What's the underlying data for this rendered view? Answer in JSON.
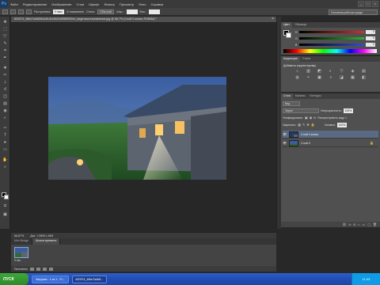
{
  "app": {
    "logo": "Ps"
  },
  "menu": [
    "Файл",
    "Редактирование",
    "Изображение",
    "Слои",
    "Шрифт",
    "Фильтр",
    "Просмотр",
    "Окно",
    "Справка"
  ],
  "window_controls": {
    "minimize": "_",
    "maximize": "□",
    "close": "×"
  },
  "options": {
    "feather_label": "Растушевка:",
    "feather_value": "0 пикс",
    "smoothing_label": "Сглаживание",
    "style_label": "Стиль:",
    "style_value": "Обычный",
    "width_label": "Шир.:",
    "height_label": "Выс.:",
    "workspace": "Основная рабочая среда"
  },
  "document": {
    "tab_title": "620374_46bc7a4b69b4c61d1e2b20d2589932cb_large-восстановление.jpg @ 66,7% (Слой 0 копия, RGB/8#) *",
    "close": "×"
  },
  "status": {
    "zoom": "66,67%",
    "doc_size": "Док: 1,58M/1,46M"
  },
  "bottom_tabs": {
    "mini_bridge": "Mini Bridge",
    "timeline": "Шкала времени"
  },
  "animation": {
    "frame_time": "0 сек.",
    "loop": "Постоянно"
  },
  "color_panel": {
    "tabs": [
      "Цвет",
      "Образцы"
    ],
    "sliders": [
      {
        "letter": "R",
        "value": "0",
        "color": "#d03030"
      },
      {
        "letter": "G",
        "value": "0",
        "color": "#30b030"
      },
      {
        "letter": "B",
        "value": "0",
        "color": "#3050d0"
      }
    ]
  },
  "adjustments_panel": {
    "tabs": [
      "Коррекция",
      "Стили"
    ],
    "title": "Добавить корректировку",
    "icons": [
      "☼",
      "▥",
      "◩",
      "◐",
      "▽",
      "◈",
      "▤",
      "◍",
      "◓",
      "▣",
      "◑",
      "◪",
      "▦",
      "◧"
    ]
  },
  "layers_panel": {
    "tabs": [
      "Слои",
      "Каналы",
      "Контуры"
    ],
    "kind_filter": "Вид",
    "blend_mode": "Экран",
    "opacity_label": "Непрозрачность:",
    "opacity_value": "100%",
    "unify_label": "Унифицировать:",
    "propagate_label": "Распространить кадр 1",
    "lock_label": "Закрепить:",
    "fill_label": "Заливка:",
    "fill_value": "100%",
    "layers": [
      {
        "name": "Слой 0 копия",
        "selected": true
      },
      {
        "name": "Слой 0",
        "selected": false
      }
    ]
  },
  "taskbar": {
    "start": "ПУСК",
    "tasks": [
      "Загрузки - 1 из 1 - Fi...",
      "620374_46bc7a4b6..."
    ],
    "time": "11:43"
  }
}
